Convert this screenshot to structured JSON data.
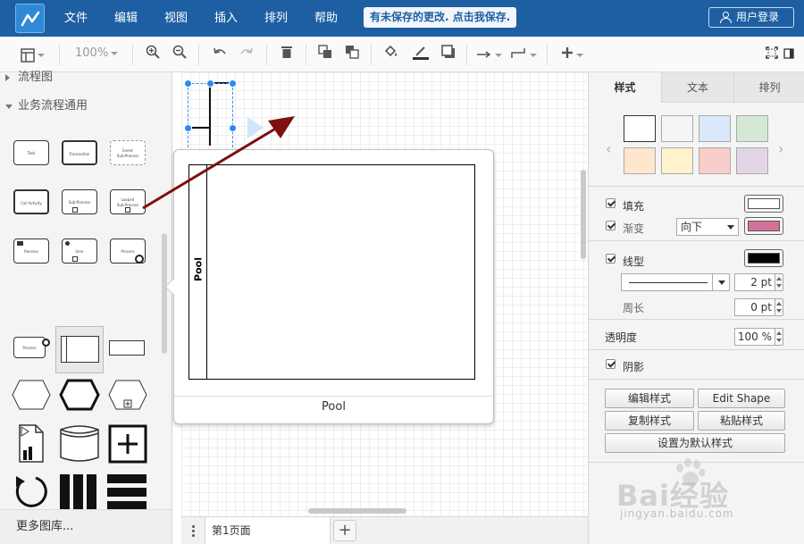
{
  "menubar": {
    "items": [
      "文件",
      "编辑",
      "视图",
      "插入",
      "排列",
      "帮助"
    ],
    "unsaved_notice": "有未保存的更改. 点击我保存.",
    "login_label": "用户登录"
  },
  "toolbar": {
    "zoom": "100%",
    "icons": [
      "layout-icon",
      "zoom-in-icon",
      "zoom-out-icon",
      "undo-icon",
      "redo-icon",
      "delete-icon",
      "to-front-icon",
      "to-back-icon",
      "fill-color-icon",
      "line-color-icon",
      "shadow-icon",
      "connection-icon",
      "waypoint-icon",
      "insert-icon",
      "fullscreen-icon",
      "format-panel-icon"
    ]
  },
  "library": {
    "sections": [
      {
        "label": "流程图"
      },
      {
        "label": "业务流程通用"
      }
    ],
    "shape_labels": {
      "task": "Task",
      "transaction": "Transaction",
      "event_sub_process": "Event\nSub-Process",
      "call_activity": "Call Activity",
      "sub_process": "Sub-Process",
      "looped_sub_process": "Looped\nSub-Process",
      "receive": "Receive",
      "user": "User",
      "process": "Process",
      "process_timer": "Process"
    },
    "more_libraries": "更多图库..."
  },
  "popup": {
    "pool_lane_label": "Pool",
    "caption": "Pool"
  },
  "pages": {
    "current_page": "第1页面",
    "add_label": "+"
  },
  "format_panel": {
    "tabs": [
      "样式",
      "文本",
      "排列"
    ],
    "swatches": [
      "#ffffff",
      "#f5f5f5",
      "#dae8fc",
      "#d5e8d4",
      "#ffe6cc",
      "#fff2cc",
      "#f8cecc",
      "#e1d5e7"
    ],
    "fill": {
      "label": "填充",
      "color": "#ffffff"
    },
    "gradient": {
      "label": "渐变",
      "direction": "向下",
      "color": "#d4719a"
    },
    "line": {
      "label": "线型",
      "color": "#000000",
      "width": "2 pt"
    },
    "perimeter": {
      "label": "周长",
      "value": "0 pt"
    },
    "opacity": {
      "label": "透明度",
      "value": "100 %"
    },
    "shadow": {
      "label": "阴影"
    },
    "buttons": {
      "edit_style": "编辑样式",
      "edit_shape": "Edit Shape",
      "copy_style": "复制样式",
      "paste_style": "粘贴样式",
      "set_default": "设置为默认样式"
    }
  },
  "watermark": {
    "text": "Bai经验",
    "url": "jingyan.baidu.com"
  }
}
